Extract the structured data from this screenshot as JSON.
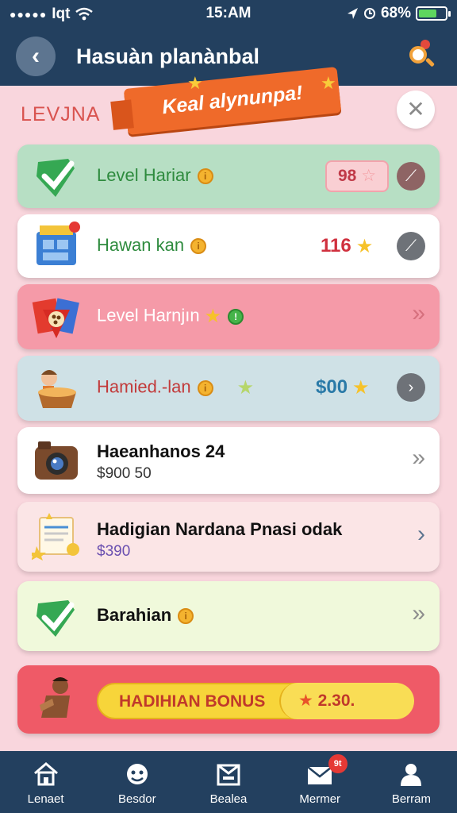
{
  "status_bar": {
    "carrier": "Iqt",
    "time": "15:AM",
    "battery": "68%",
    "battery_level": 0.68
  },
  "header": {
    "title": "Hasuàn planànbal",
    "back_icon": "back-arrow-icon",
    "search_icon": "search-icon"
  },
  "panel": {
    "section_label": "LEVJNA",
    "banner_text": "Keal alynunpa!",
    "close_icon": "close-icon"
  },
  "rows": [
    {
      "label": "Level Hariar",
      "badge": "98"
    },
    {
      "label": "Hawan kan",
      "amount": "116"
    },
    {
      "label": "Level Harnjın"
    },
    {
      "label": "Hamied.-lan",
      "amount": "$00"
    },
    {
      "label": "Haeanhanos 24",
      "sub": "$900 50"
    },
    {
      "label": "Hadigian Nardana Pnasi odak",
      "sub": "$390"
    },
    {
      "label": "Barahian"
    },
    {
      "bonus_label": "HADIHIAN BONUS",
      "bonus_value": "2.30."
    }
  ],
  "tabs": [
    {
      "label": "Lenaet",
      "icon": "home-icon"
    },
    {
      "label": "Besdor",
      "icon": "face-icon"
    },
    {
      "label": "Bealea",
      "icon": "store-icon"
    },
    {
      "label": "Mermer",
      "icon": "mail-icon",
      "badge": "9t"
    },
    {
      "label": "Berram",
      "icon": "profile-icon"
    }
  ],
  "colors": {
    "header_bg": "#23405f",
    "panel_bg": "#f9d6dd",
    "banner": "#ef6a2a",
    "accent_red": "#d9534f",
    "bonus_yellow": "#f7d53a"
  }
}
